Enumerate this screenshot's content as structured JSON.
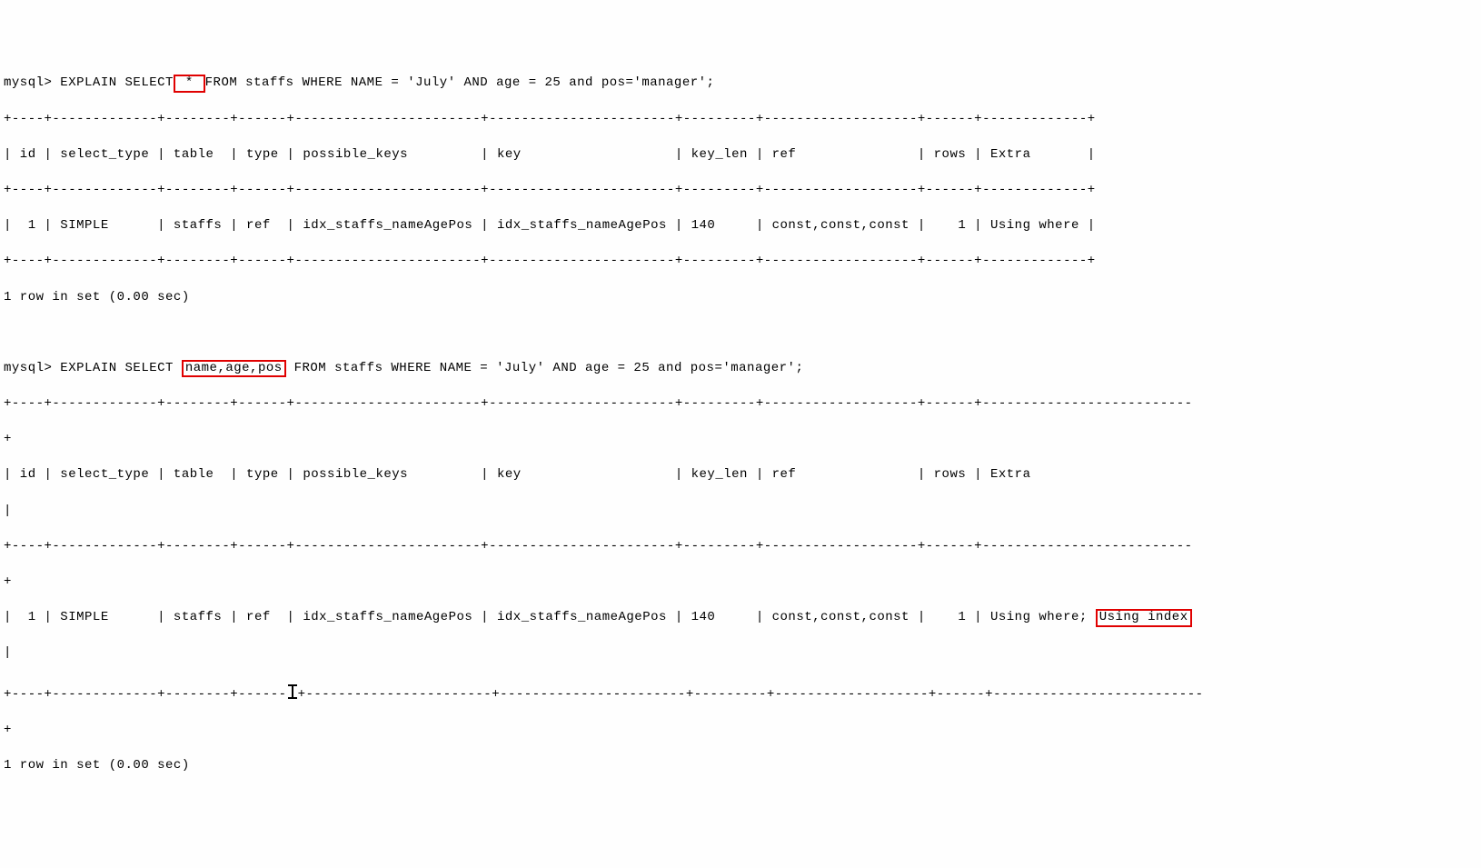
{
  "q1": {
    "prompt_pre": "mysql> EXPLAIN SELECT",
    "hl": " * ",
    "prompt_post": "FROM staffs WHERE NAME = 'July' AND age = 25 and pos='manager';",
    "sep": "+----+-------------+--------+------+-----------------------+-----------------------+---------+-------------------+------+-------------+",
    "header": "| id | select_type | table  | type | possible_keys         | key                   | key_len | ref               | rows | Extra       |",
    "row": "|  1 | SIMPLE      | staffs | ref  | idx_staffs_nameAgePos | idx_staffs_nameAgePos | 140     | const,const,const |    1 | Using where |",
    "footer": "1 row in set (0.00 sec)"
  },
  "q2": {
    "prompt_pre": "mysql> EXPLAIN SELECT ",
    "hl": "name,age,pos",
    "prompt_post": " FROM staffs WHERE NAME = 'July' AND age = 25 and pos='manager';",
    "sep_a": "+----+-------------+--------+------+-----------------------+-----------------------+---------+-------------------+------+--------------------------",
    "sep_b": "+",
    "header_a": "| id | select_type | table  | type | possible_keys         | key                   | key_len | ref               | rows | Extra                    ",
    "header_b": "|",
    "row_a": "|  1 | SIMPLE      | staffs | ref  | idx_staffs_nameAgePos | idx_staffs_nameAgePos | 140     | const,const,const |    1 | Using where; ",
    "row_hl": "Using index",
    "row_b": " ",
    "row_c": "|",
    "sep2_a": "+----+-------------+--------+------",
    "sep2_b": "+-----------------------+-----------------------+---------+-------------------+------+--------------------------",
    "sep2_c": "+",
    "footer": "1 row in set (0.00 sec)"
  },
  "chart_data": {
    "type": "table",
    "queries": [
      {
        "sql": "EXPLAIN SELECT * FROM staffs WHERE NAME = 'July' AND age = 25 and pos='manager';",
        "highlight": "*",
        "columns": [
          "id",
          "select_type",
          "table",
          "type",
          "possible_keys",
          "key",
          "key_len",
          "ref",
          "rows",
          "Extra"
        ],
        "rows": [
          {
            "id": 1,
            "select_type": "SIMPLE",
            "table": "staffs",
            "type": "ref",
            "possible_keys": "idx_staffs_nameAgePos",
            "key": "idx_staffs_nameAgePos",
            "key_len": 140,
            "ref": "const,const,const",
            "rows": 1,
            "Extra": "Using where"
          }
        ],
        "footer": "1 row in set (0.00 sec)"
      },
      {
        "sql": "EXPLAIN SELECT name,age,pos FROM staffs WHERE NAME = 'July' AND age = 25 and pos='manager';",
        "highlight": "name,age,pos",
        "columns": [
          "id",
          "select_type",
          "table",
          "type",
          "possible_keys",
          "key",
          "key_len",
          "ref",
          "rows",
          "Extra"
        ],
        "rows": [
          {
            "id": 1,
            "select_type": "SIMPLE",
            "table": "staffs",
            "type": "ref",
            "possible_keys": "idx_staffs_nameAgePos",
            "key": "idx_staffs_nameAgePos",
            "key_len": 140,
            "ref": "const,const,const",
            "rows": 1,
            "Extra": "Using where; Using index"
          }
        ],
        "extra_highlight": "Using index",
        "footer": "1 row in set (0.00 sec)"
      }
    ]
  }
}
